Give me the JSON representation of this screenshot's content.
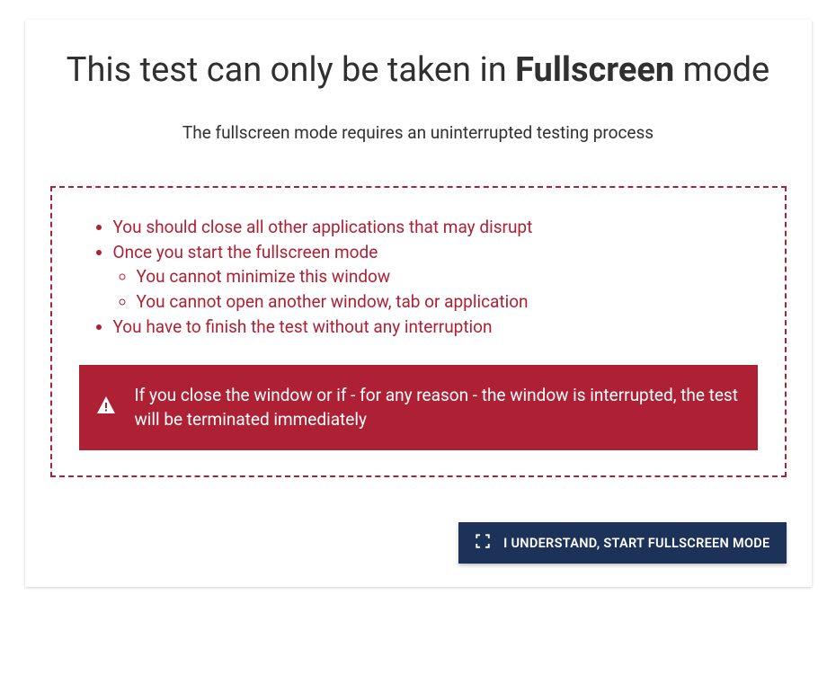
{
  "title": {
    "prefix": "This test can only be taken in ",
    "bold": "Fullscreen",
    "suffix": " mode"
  },
  "subtitle": "The fullscreen mode requires an uninterrupted testing process",
  "rules": {
    "item1": "You should close all other applications that may disrupt",
    "item2": "Once you start the fullscreen mode",
    "item2_sub1": "You cannot minimize this window",
    "item2_sub2": "You cannot open another window, tab or application",
    "item3": "You have to finish the test without any interruption"
  },
  "alert_text": "If you close the window or if - for any reason - the window is interrupted, the test will be terminated immediately",
  "button_label": "I UNDERSTAND, START FULLSCREEN MODE",
  "colors": {
    "accent_red": "#AE2134",
    "button_navy": "#1C3258"
  }
}
